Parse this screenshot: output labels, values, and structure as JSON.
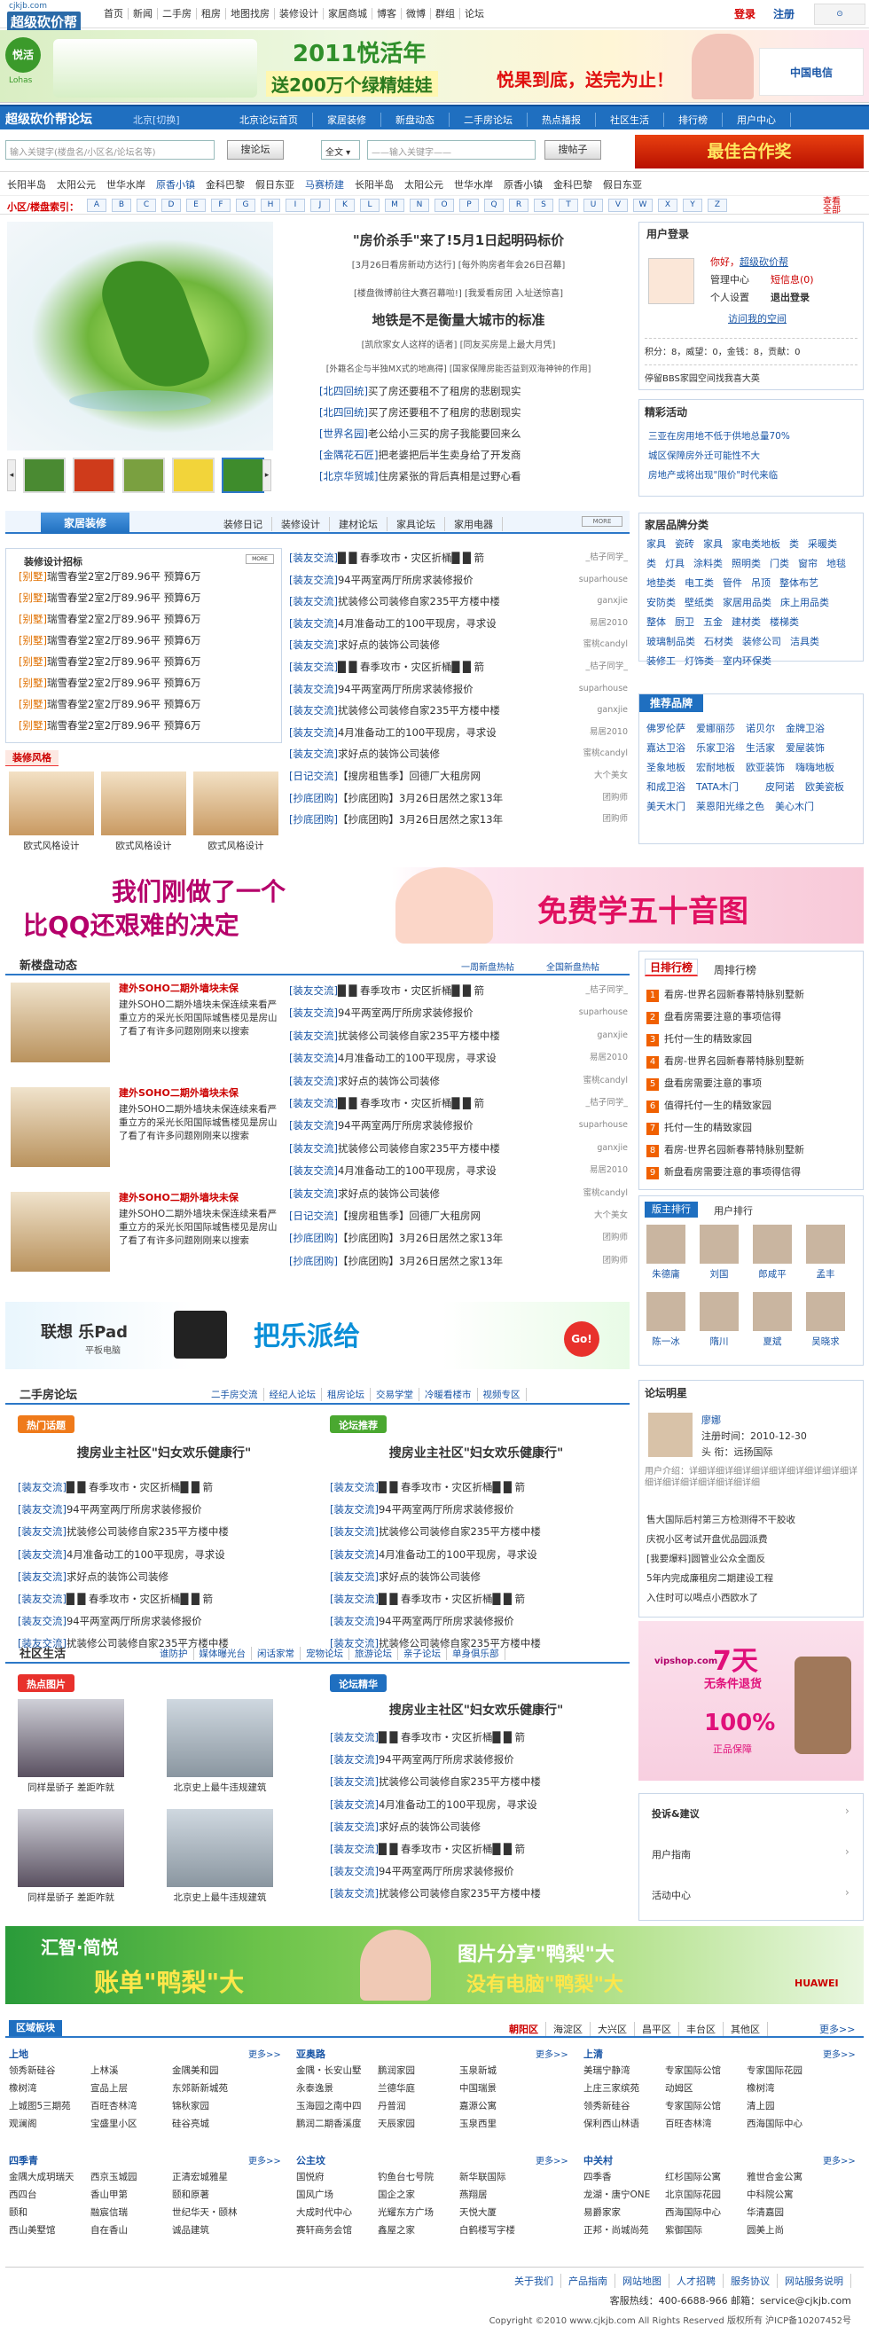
{
  "site": {
    "logo_small": "cjkjb.com",
    "logo_big": "超级砍价帮"
  },
  "topnav": [
    "首页",
    "新闻",
    "二手房",
    "租房",
    "地图找房",
    "装修设计",
    "家居商城",
    "博客",
    "微博",
    "群组",
    "论坛"
  ],
  "auth": {
    "login": "登录",
    "register": "注册"
  },
  "banner_top": {
    "brand": "悦活",
    "brand_en": "Lohas",
    "title": "2011悦活年",
    "sub": "送200万个绿精娃娃",
    "slogan": "悦果到底，送完为止！",
    "right_brand": "中国电信"
  },
  "bluebar": {
    "title": "超级砍价帮论坛",
    "switch": "北京[切换]",
    "menu": [
      "北京论坛首页",
      "家居装修",
      "新盘动态",
      "二手房论坛",
      "热点播报",
      "社区生活",
      "排行榜",
      "用户中心"
    ]
  },
  "search": {
    "ph1": "输入关键字(楼盘名/小区名/论坛名等)",
    "btn1": "搜论坛",
    "select": "全文",
    "ph2": "——输入关键字——",
    "btn2": "搜帖子",
    "ad": "最佳合作奖"
  },
  "hot": [
    "长阳半岛",
    "太阳公元",
    "世华水岸",
    "原香小镇",
    "金科巴黎",
    "假日东亚",
    "马赛桥建",
    "长阳半岛",
    "太阳公元",
    "世华水岸",
    "原香小镇",
    "金科巴黎",
    "假日东亚"
  ],
  "letters": {
    "label": "小区/楼盘索引：",
    "items": [
      "A",
      "B",
      "C",
      "D",
      "E",
      "F",
      "G",
      "H",
      "I",
      "J",
      "K",
      "L",
      "M",
      "N",
      "O",
      "P",
      "Q",
      "R",
      "S",
      "T",
      "U",
      "V",
      "W",
      "X",
      "Y",
      "Z"
    ],
    "more": "查看全部"
  },
  "headline": {
    "t1": "\"房价杀手\"来了!5月1日起明码标价",
    "t1sub": "[3月26日看房新动方达行] [每外购房者年会26日召幕]",
    "t1sub2": "[楼盘微博前往大赛召幕啦!] [我爱看房团 入址送惊喜]",
    "t2": "地铁是不是衡量大城市的标准",
    "t2sub": "[凯欣家女人这样的语者] [同友买房是上最大月凭]",
    "t2sub2": "[外籍名企与半独MX式的地高得] [国家保障房能否益到双海神钟的作用]",
    "links": [
      {
        "tag": "[北四回统]",
        "text": "买了房还要租不了租房的悲剧现实"
      },
      {
        "tag": "[北四回统]",
        "text": "买了房还要租不了租房的悲剧现实"
      },
      {
        "tag": "[世界名园]",
        "text": "老公给小三买的房子我能要回来么"
      },
      {
        "tag": "[金隅花石匠]",
        "text": "把老婆把后半生卖身给了开发商"
      },
      {
        "tag": "[北京华贸城]",
        "text": "住房紧张的背后真相是过野心看"
      }
    ]
  },
  "user": {
    "title": "用户登录",
    "name": "超级砍价帮",
    "greet": "你好，",
    "role": "管理中心",
    "msg": "短信息(0)",
    "center": "个人设置",
    "logout": "退出登录",
    "visit": "访问我的空间",
    "stats": "积分：8，威望：0，金钱：8，贡献：0",
    "notice": "停留BBS家园空间找我喜大英"
  },
  "activity": {
    "title": "精彩活动",
    "items": [
      "三亚在房用地不低于供地总量70%",
      "城区保障房外迁可能性不大",
      "房地产或将出现\"限价\"时代来临"
    ]
  },
  "deco": {
    "title": "家居装修",
    "menu": [
      "装修日记",
      "装修设计",
      "建材论坛",
      "家具论坛",
      "家用电器"
    ],
    "design_title": "装修设计招标",
    "design_items": [
      {
        "tag": "[别墅]",
        "text": "瑞雪春堂2室2厅89.96平 预算6万"
      },
      {
        "tag": "[别墅]",
        "text": "瑞雪春堂2室2厅89.96平 预算6万"
      },
      {
        "tag": "[别墅]",
        "text": "瑞雪春堂2室2厅89.96平 预算6万"
      },
      {
        "tag": "[别墅]",
        "text": "瑞雪春堂2室2厅89.96平 预算6万"
      },
      {
        "tag": "[别墅]",
        "text": "瑞雪春堂2室2厅89.96平 预算6万"
      },
      {
        "tag": "[别墅]",
        "text": "瑞雪春堂2室2厅89.96平 预算6万"
      },
      {
        "tag": "[别墅]",
        "text": "瑞雪春堂2室2厅89.96平 预算6万"
      },
      {
        "tag": "[别墅]",
        "text": "瑞雪春堂2室2厅89.96平 预算6万"
      }
    ],
    "style_title": "装修风格",
    "pics": [
      "欧式风格设计",
      "欧式风格设计",
      "欧式风格设计"
    ]
  },
  "posts": [
    {
      "tag": "[装友交流]",
      "text": "█ █ 春季攻市・灾区折桶█ █ 箭",
      "user": "_桔子同学_"
    },
    {
      "tag": "[装友交流]",
      "text": "94平两室两厅所房求装修报价",
      "user": "suparhouse"
    },
    {
      "tag": "[装友交流]",
      "text": "扰装修公司装修自家235平方楼中楼",
      "user": "ganxjie"
    },
    {
      "tag": "[装友交流]",
      "text": "4月准备动工的100平现房，寻求设",
      "user": "易居2010"
    },
    {
      "tag": "[装友交流]",
      "text": "求好点的装饰公司装修",
      "user": "蜜桃candyl"
    },
    {
      "tag": "[装友交流]",
      "text": "█ █ 春季攻市・灾区折桶█ █ 箭",
      "user": "_桔子同学_"
    },
    {
      "tag": "[装友交流]",
      "text": "94平两室两厅所房求装修报价",
      "user": "suparhouse"
    },
    {
      "tag": "[装友交流]",
      "text": "扰装修公司装修自家235平方楼中楼",
      "user": "ganxjie"
    },
    {
      "tag": "[装友交流]",
      "text": "4月准备动工的100平现房，寻求设",
      "user": "易居2010"
    },
    {
      "tag": "[装友交流]",
      "text": "求好点的装饰公司装修",
      "user": "蜜桃candyl"
    },
    {
      "tag": "[日记交流]",
      "text": "【搜房租售季】回德厂大租房网",
      "user": "大个美女"
    },
    {
      "tag": "[抄底团购]",
      "text": "【抄底团购】3月26日居然之家13年",
      "user": "团购师"
    },
    {
      "tag": "[抄底团购]",
      "text": "【抄底团购】3月26日居然之家13年",
      "user": "团购师"
    }
  ],
  "brands": {
    "title": "家居品牌分类",
    "items": [
      "家具",
      "瓷砖",
      "家具",
      "家电类地板",
      "类",
      "采暖类",
      "类",
      "灯具",
      "涂料类",
      "照明类",
      "门类",
      "窗帘",
      "地毯",
      "地垫类",
      "电工类",
      "管件",
      "吊顶",
      "整体布艺",
      "安防类",
      "壁纸类",
      "家居用品类",
      "床上用品类",
      "整体",
      "厨卫",
      "五金",
      "建材类",
      "楼梯类",
      "玻璃制品类",
      "石材类",
      "装修公司",
      "洁具类",
      "装修工",
      "灯饰类",
      "室内环保类"
    ],
    "rec_title": "推荐品牌",
    "rec": [
      "佛罗伦萨",
      "爱娜丽莎",
      "诺贝尔",
      "金牌卫浴",
      "嘉达卫浴",
      "乐家卫浴",
      "生活家",
      "爱屋装饰",
      "圣象地板",
      "宏耐地板",
      "欧亚装饰",
      "嗨嗨地板",
      "和成卫浴",
      "TATA木门",
      "皮阿诺",
      "欧美瓷板",
      "美天木门",
      "莱恩阳光缘之色",
      "美心木门"
    ]
  },
  "ad2": {
    "line1": "我们刚做了一个",
    "line2": "比QQ还艰难的决定",
    "right": "免费学五十音图"
  },
  "newhouse": {
    "title": "新楼盘动态",
    "links": [
      "一周新盘热帖",
      "全国新盘热帖"
    ],
    "items": [
      {
        "title": "建外SOHO二期外墙块未保",
        "desc": "建外SOHO二期外墙块未保连续来看严重立方的采光长阳国际城售楼见是房山了看了有许多问题刚刚来以搜索"
      },
      {
        "title": "建外SOHO二期外墙块未保",
        "desc": "建外SOHO二期外墙块未保连续来看严重立方的采光长阳国际城售楼见是房山了看了有许多问题刚刚来以搜索"
      },
      {
        "title": "建外SOHO二期外墙块未保",
        "desc": "建外SOHO二期外墙块未保连续来看严重立方的采光长阳国际城售楼见是房山了看了有许多问题刚刚来以搜索"
      }
    ]
  },
  "rank": {
    "tab1": "日排行榜",
    "tab2": "周排行榜",
    "items": [
      "看房-世界名园新春蒂特脉别墅新",
      "盘看房需要注意的事项信得",
      "托付一生的精致家园",
      "看房-世界名园新春蒂特脉别墅新",
      "盘看房需要注意的事项",
      "值得托付一生的精致家园",
      "托付一生的精致家园",
      "看房-世界名园新春蒂特脉别墅新",
      "新盘看房需要注意的事项得信得"
    ],
    "tab3": "版主排行",
    "tab4": "用户排行",
    "people": [
      "朱德庸",
      "刘国",
      "郎咸平",
      "孟丰",
      "陈一冰",
      "隋川",
      "夏斌",
      "吴晓求"
    ]
  },
  "lepad": {
    "brand": "联想 乐Pad",
    "sub": "平板电脑",
    "slogan": "把乐派给",
    "go": "Go!"
  },
  "second": {
    "title": "二手房论坛",
    "menu": [
      "二手房交流",
      "经纪人论坛",
      "租房论坛",
      "交易学堂",
      "冷暖看楼市",
      "视频专区"
    ],
    "hot": "热门话题",
    "rec": "论坛推荐",
    "topic": "搜房业主社区\"妇女欢乐健康行\"",
    "topic2": "搜房业主社区\"妇女欢乐健康行\""
  },
  "star": {
    "title": "论坛明星",
    "name": "廖娜",
    "reg": "注册时间：2010-12-30",
    "rank": "头 衔：远扬国际",
    "desc": "用户介绍：详细详细详细详细详细详细详细详细详细详细详细详细详细详细详细详细",
    "items": [
      "售大国际后村第三方检测得不干胶收",
      "庆祝小区考试开盘优品园派费",
      "[我要爆料]圆管业公众全面反",
      "5年内完成廉租房二期建设工程",
      "入住时可以喝点小西欧水了"
    ]
  },
  "community": {
    "title": "社区生活",
    "menu": [
      "谁防护",
      "媒体曝光台",
      "闲话家常",
      "宠物论坛",
      "旅游论坛",
      "亲子论坛",
      "单身俱乐部"
    ],
    "hot": "热点图片",
    "rec": "论坛精华",
    "pics": [
      "同样是骄子 差距咋就",
      "北京史上最牛违规建筑",
      "同样是骄子 差距咋就",
      "北京史上最牛违规建筑"
    ]
  },
  "vip": {
    "big": "7天",
    "line": "无条件退货",
    "pct": "100%",
    "note": "正品保障",
    "site": "vipshop.com"
  },
  "suggest": {
    "items": [
      "投诉&建议",
      "用户指南",
      "活动中心"
    ]
  },
  "ad3": {
    "brand": "汇智·简悦",
    "slogan": "账单\"鸭梨\"大",
    "mid": "图片分享\"鸭梨\"大",
    "mid2": "没有电脑\"鸭梨\"大",
    "right": "HUAWEI"
  },
  "regions": {
    "title": "区域板块",
    "tabs": [
      "朝阳区",
      "海淀区",
      "大兴区",
      "昌平区",
      "丰台区",
      "其他区"
    ],
    "more": "更多>>",
    "cols": [
      {
        "h": "上地",
        "items": [
          "领秀新硅谷",
          "上林溪",
          "金隅美和园",
          "橡树湾",
          "宣品上层",
          "东郊新新城苑",
          "上城图5三期苑",
          "百旺杏林湾",
          "锦秋家园",
          "观澜阁",
          "宝盛里小区",
          "硅谷亮城"
        ]
      },
      {
        "h": "亚奥路",
        "items": [
          "金隅・长安山墅",
          "鹏润家园",
          "玉泉新城",
          "永泰逸景",
          "兰德华庭",
          "中国瑞景",
          "玉海园之南中四",
          "丹普润",
          "嘉源公寓",
          "鹏润二期香溪度",
          "天辰家园",
          "玉泉西里"
        ]
      },
      {
        "h": "上清",
        "items": [
          "美瑞宁静湾",
          "专家国际公馆",
          "专家国际花园",
          "上庄三家缤苑",
          "动姆区",
          "橡树湾",
          "领秀新硅谷",
          "专家国际公馆",
          "清上园",
          "保利西山林语",
          "百旺杏林湾",
          "西海国际中心"
        ]
      },
      {
        "h": "四季青",
        "items": [
          "金隅大成玥瑞天",
          "西京玉城园",
          "正清宏城雅星",
          "西四台",
          "香山甲第",
          "颐和原著",
          "颐和",
          "融宸信瑞",
          "世纪华天・颐林",
          "西山美墅馆",
          "自在香山",
          "诚品建筑"
        ]
      },
      {
        "h": "公主坟",
        "items": [
          "国悦府",
          "钓鱼台七号院",
          "新华联国际",
          "国风广场",
          "国企之家",
          "燕翔居",
          "大成时代中心",
          "光耀东方广场",
          "天悦大厦",
          "赛轩商务会馆",
          "鑫屋之家",
          "白鹤楼写字楼"
        ]
      },
      {
        "h": "中关村",
        "items": [
          "四季香",
          "红杉国际公寓",
          "雅世合金公寓",
          "龙湖・唐宁ONE",
          "北京国际花园",
          "中科院公寓",
          "易爵家家",
          "西海国际中心",
          "华清嘉园",
          "正邦・尚城尚苑",
          "紫御国际",
          "圆美上尚"
        ]
      }
    ]
  },
  "footer": {
    "links": [
      "关于我们",
      "产品指南",
      "网站地图",
      "人才招聘",
      "服务协议",
      "网站服务说明"
    ],
    "service": "客服热线：400-6688-966  邮箱：service@cjkjb.com",
    "copy": "Copyright ©2010 www.cjkjb.com All Rights Reserved 版权所有 沪ICP备10207452号"
  }
}
